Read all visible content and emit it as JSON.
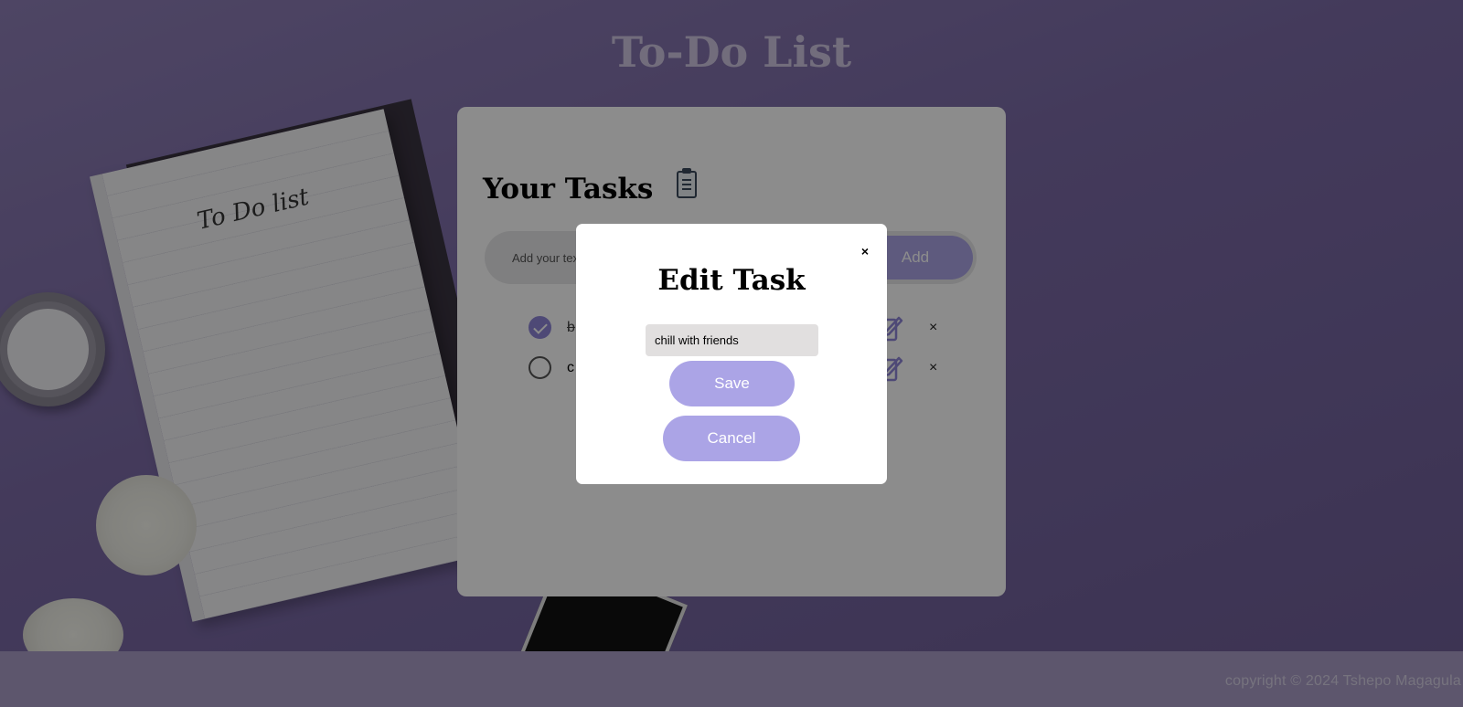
{
  "page": {
    "title": "To-Do List",
    "copyright": "copyright © 2024 Tshepo Magagula"
  },
  "background": {
    "notebook_title": "To Do list"
  },
  "card": {
    "heading": "Your Tasks",
    "heading_icon": "clipboard-icon",
    "input_placeholder": "Add your text",
    "add_label": "Add"
  },
  "tasks": [
    {
      "text": "b",
      "completed": true,
      "edit_icon": "edit-icon",
      "delete_icon": "×"
    },
    {
      "text": "c",
      "completed": false,
      "edit_icon": "edit-icon",
      "delete_icon": "×"
    }
  ],
  "modal": {
    "title": "Edit Task",
    "close_label": "×",
    "input_value": "chill with friends",
    "save_label": "Save",
    "cancel_label": "Cancel"
  },
  "colors": {
    "accent": "#aba4e6",
    "background": "#7b6aa6",
    "footer": "#a99dc6"
  }
}
